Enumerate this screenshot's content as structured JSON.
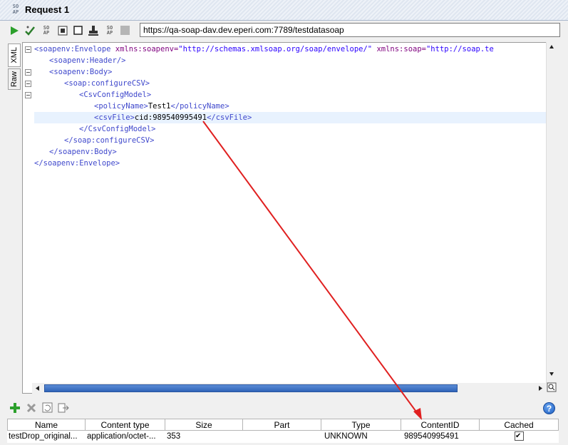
{
  "window": {
    "badge": [
      "SO",
      "AP"
    ],
    "title": "Request 1"
  },
  "toolbar": {
    "url": "https://qa-soap-dav.dev.eperi.com:7789/testdatasoap",
    "icons": [
      "run-icon",
      "validate-icon",
      "soap-icon",
      "format-icon",
      "stop-icon",
      "stamp-icon",
      "soap-icon",
      "stop-icon"
    ]
  },
  "tabs": {
    "xml": "XML",
    "raw": "Raw"
  },
  "editor": {
    "lines": [
      {
        "indent": 0,
        "open": "<soapenv:Envelope",
        "attrs": " xmlns:soapenv=",
        "val1": "\"http://schemas.xmlsoap.org/soap/envelope/\"",
        "attrs2": " xmlns:soap=",
        "val2": "\"http://soap.te"
      },
      {
        "indent": 1,
        "text": "<soapenv:Header/>"
      },
      {
        "indent": 1,
        "text": "<soapenv:Body>"
      },
      {
        "indent": 2,
        "text": "<soap:configureCSV>"
      },
      {
        "indent": 3,
        "text": "<CsvConfigModel>"
      },
      {
        "indent": 4,
        "open": "<policyName>",
        "content": "Test1",
        "close": "</policyName>"
      },
      {
        "indent": 4,
        "open": "<csvFile>",
        "content": "cid:989540995491",
        "close": "</csvFile>"
      },
      {
        "indent": 3,
        "text": "</CsvConfigModel>"
      },
      {
        "indent": 2,
        "text": "</soap:configureCSV>"
      },
      {
        "indent": 1,
        "text": "</soapenv:Body>"
      },
      {
        "indent": 0,
        "text": "</soapenv:Envelope>"
      }
    ]
  },
  "attachments": {
    "help": "?",
    "columns": [
      "Name",
      "Content type",
      "Size",
      "Part",
      "Type",
      "ContentID",
      "Cached"
    ],
    "rows": [
      {
        "name": "testDrop_original...",
        "content_type": "application/octet-...",
        "size": "353",
        "part": "",
        "type": "UNKNOWN",
        "content_id": "989540995491",
        "cached": true
      }
    ]
  },
  "colors": {
    "arrow": "#e02020",
    "accent": "#2f64b8"
  }
}
